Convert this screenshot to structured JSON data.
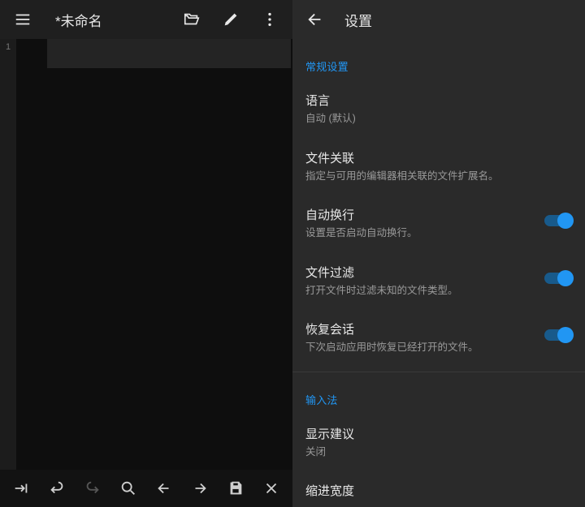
{
  "left": {
    "title": "*未命名",
    "gutter_line": "1",
    "bottom_icons": [
      "tab-arrow-icon",
      "undo-icon",
      "redo-icon",
      "search-icon",
      "arrow-left-icon",
      "arrow-right-icon",
      "save-icon",
      "close-icon"
    ]
  },
  "right": {
    "title": "设置",
    "sections": [
      {
        "label": "常规设置",
        "items": [
          {
            "title": "语言",
            "sub": "自动 (默认)",
            "toggle": false
          },
          {
            "title": "文件关联",
            "sub": "指定与可用的编辑器相关联的文件扩展名。",
            "toggle": false
          },
          {
            "title": "自动换行",
            "sub": "设置是否启动自动换行。",
            "toggle": true
          },
          {
            "title": "文件过滤",
            "sub": "打开文件时过滤未知的文件类型。",
            "toggle": true
          },
          {
            "title": "恢复会话",
            "sub": "下次启动应用时恢复已经打开的文件。",
            "toggle": true
          }
        ]
      },
      {
        "label": "输入法",
        "items": [
          {
            "title": "显示建议",
            "sub": "关闭",
            "toggle": false
          },
          {
            "title": "缩进宽度",
            "sub": "",
            "toggle": false
          }
        ]
      }
    ]
  }
}
